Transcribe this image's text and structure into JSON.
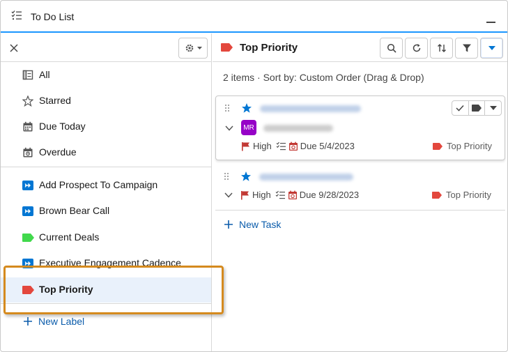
{
  "window": {
    "title": "To Do List"
  },
  "sidebar": {
    "views": [
      {
        "label": "All",
        "icon": "list-view-icon"
      },
      {
        "label": "Starred",
        "icon": "star-icon"
      },
      {
        "label": "Due Today",
        "icon": "calendar-icon"
      },
      {
        "label": "Overdue",
        "icon": "calendar-alert-icon"
      }
    ],
    "labels": [
      {
        "label": "Add Prospect To Campaign",
        "icon": "cadence-icon",
        "color": "#0176d3"
      },
      {
        "label": "Brown Bear Call",
        "icon": "cadence-icon",
        "color": "#0176d3"
      },
      {
        "label": "Current Deals",
        "icon": "tag-icon",
        "color": "#41d94c"
      },
      {
        "label": "Executive Engagement Cadence",
        "icon": "cadence-icon",
        "color": "#0176d3"
      },
      {
        "label": "Top Priority",
        "icon": "tag-icon",
        "color": "#e3473d",
        "selected": true
      }
    ],
    "new_label": "New Label"
  },
  "main": {
    "header_title": "Top Priority",
    "header_tag_color": "#e3473d",
    "summary": "2 items · Sort by: Custom Order (Drag & Drop)",
    "tasks": [
      {
        "avatar_initials": "MR",
        "avatar_color": "#9602c7",
        "priority": "High",
        "due": "Due 5/4/2023",
        "label": "Top Priority"
      },
      {
        "priority": "High",
        "due": "Due 9/28/2023",
        "label": "Top Priority"
      }
    ],
    "new_task": "New Task"
  },
  "colors": {
    "accent": "#0176d3",
    "link": "#0b5cab",
    "highlight": "#d58a1e",
    "flag": "#c23934",
    "star": "#0176d3"
  }
}
